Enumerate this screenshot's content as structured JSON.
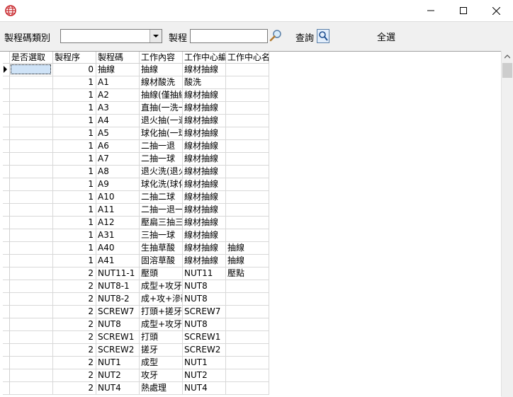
{
  "window": {
    "minimize_glyph": "─",
    "maximize_glyph": "☐",
    "close_glyph": "✕"
  },
  "toolbar": {
    "category_label": "製程碼類別",
    "category_value": "",
    "process_label": "製程",
    "process_value": "",
    "query_label": "查詢",
    "select_all_label": "全選"
  },
  "grid": {
    "columns": [
      "是否選取",
      "製程序",
      "製程碼",
      "工作內容",
      "工作中心編",
      "工作中心名"
    ],
    "rows": [
      {
        "seq": "0",
        "code": "抽線",
        "content": "抽線",
        "wc_code": "線材抽線",
        "wc_name": ""
      },
      {
        "seq": "1",
        "code": "A1",
        "content": "線材酸洗",
        "wc_code": "酸洗",
        "wc_name": ""
      },
      {
        "seq": "1",
        "code": "A2",
        "content": "抽線(僅抽線",
        "wc_code": "線材抽線",
        "wc_name": ""
      },
      {
        "seq": "1",
        "code": "A3",
        "content": "直抽(一洗一",
        "wc_code": "線材抽線",
        "wc_name": ""
      },
      {
        "seq": "1",
        "code": "A4",
        "content": "退火抽(一退",
        "wc_code": "線材抽線",
        "wc_name": ""
      },
      {
        "seq": "1",
        "code": "A5",
        "content": "球化抽(一球",
        "wc_code": "線材抽線",
        "wc_name": ""
      },
      {
        "seq": "1",
        "code": "A6",
        "content": "二抽一退",
        "wc_code": "線材抽線",
        "wc_name": ""
      },
      {
        "seq": "1",
        "code": "A7",
        "content": "二抽一球",
        "wc_code": "線材抽線",
        "wc_name": ""
      },
      {
        "seq": "1",
        "code": "A8",
        "content": "退火洗(退火",
        "wc_code": "線材抽線",
        "wc_name": ""
      },
      {
        "seq": "1",
        "code": "A9",
        "content": "球化洗(球化",
        "wc_code": "線材抽線",
        "wc_name": ""
      },
      {
        "seq": "1",
        "code": "A10",
        "content": "二抽二球",
        "wc_code": "線材抽線",
        "wc_name": ""
      },
      {
        "seq": "1",
        "code": "A11",
        "content": "二抽一退一",
        "wc_code": "線材抽線",
        "wc_name": ""
      },
      {
        "seq": "1",
        "code": "A12",
        "content": "壓扁三抽三",
        "wc_code": "線材抽線",
        "wc_name": ""
      },
      {
        "seq": "1",
        "code": "A31",
        "content": "三抽一球",
        "wc_code": "線材抽線",
        "wc_name": ""
      },
      {
        "seq": "1",
        "code": "A40",
        "content": "生抽草酸",
        "wc_code": "線材抽線",
        "wc_name": "抽線"
      },
      {
        "seq": "1",
        "code": "A41",
        "content": "固溶草酸",
        "wc_code": "線材抽線",
        "wc_name": "抽線"
      },
      {
        "seq": "2",
        "code": "NUT11-1",
        "content": "壓頭",
        "wc_code": "NUT11",
        "wc_name": "壓點"
      },
      {
        "seq": "2",
        "code": "NUT8-1",
        "content": "成型+攻牙+",
        "wc_code": "NUT8",
        "wc_name": ""
      },
      {
        "seq": "2",
        "code": "NUT8-2",
        "content": "成+攻+滲碳",
        "wc_code": "NUT8",
        "wc_name": ""
      },
      {
        "seq": "2",
        "code": "SCREW7",
        "content": "打頭+搓牙",
        "wc_code": "SCREW7",
        "wc_name": ""
      },
      {
        "seq": "2",
        "code": "NUT8",
        "content": "成型+攻牙",
        "wc_code": "NUT8",
        "wc_name": ""
      },
      {
        "seq": "2",
        "code": "SCREW1",
        "content": "打頭",
        "wc_code": "SCREW1",
        "wc_name": ""
      },
      {
        "seq": "2",
        "code": "SCREW2",
        "content": "搓牙",
        "wc_code": "SCREW2",
        "wc_name": ""
      },
      {
        "seq": "2",
        "code": "NUT1",
        "content": "成型",
        "wc_code": "NUT1",
        "wc_name": ""
      },
      {
        "seq": "2",
        "code": "NUT2",
        "content": "攻牙",
        "wc_code": "NUT2",
        "wc_name": ""
      },
      {
        "seq": "2",
        "code": "NUT4",
        "content": "熱處理",
        "wc_code": "NUT4",
        "wc_name": ""
      }
    ]
  }
}
